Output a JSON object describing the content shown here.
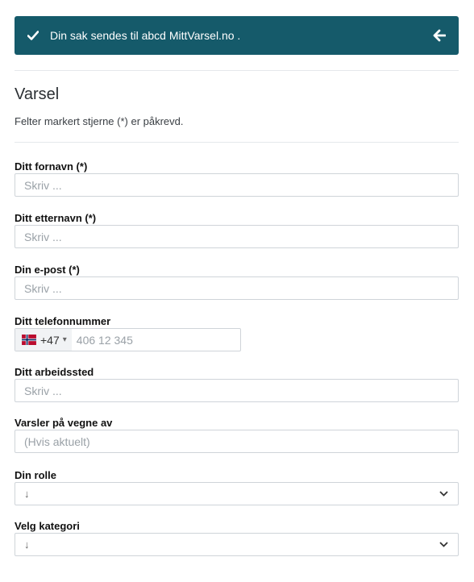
{
  "banner": {
    "message": "Din sak sendes til abcd MittVarsel.no .",
    "bg": "#155a6a"
  },
  "form": {
    "title": "Varsel",
    "subtitle": "Felter markert stjerne (*) er påkrevd.",
    "first_name": {
      "label": "Ditt fornavn (*)",
      "placeholder": "Skriv ..."
    },
    "last_name": {
      "label": "Ditt etternavn (*)",
      "placeholder": "Skriv ..."
    },
    "email": {
      "label": "Din e-post (*)",
      "placeholder": "Skriv ..."
    },
    "phone": {
      "label": "Ditt telefonnummer",
      "country": "NO",
      "country_code": "+47",
      "placeholder": "406 12 345"
    },
    "workplace": {
      "label": "Ditt arbeidssted",
      "placeholder": "Skriv ..."
    },
    "on_behalf": {
      "label": "Varsler på vegne av",
      "placeholder": "(Hvis aktuelt)"
    },
    "role": {
      "label": "Din rolle",
      "value": "↓"
    },
    "category": {
      "label": "Velg kategori",
      "value": "↓"
    }
  }
}
